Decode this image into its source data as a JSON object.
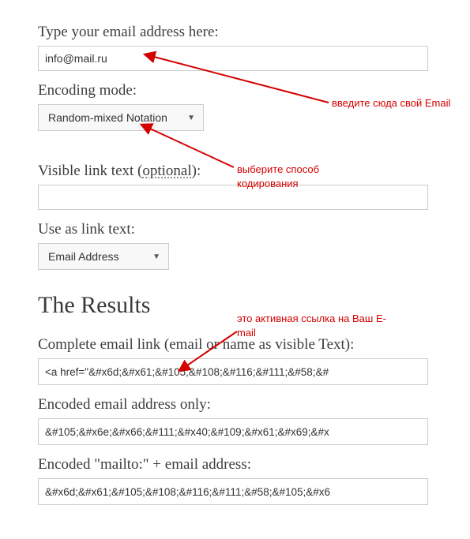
{
  "form": {
    "email_label": "Type your email address here:",
    "email_value": "info@mail.ru",
    "encoding_label": "Encoding mode:",
    "encoding_value": "Random-mixed Notation",
    "visible_label_pre": "Visible link text (",
    "visible_label_opt": "optional",
    "visible_label_post": "):",
    "visible_value": "",
    "linktext_label": "Use as link text:",
    "linktext_value": "Email Address"
  },
  "results": {
    "heading": "The Results",
    "complete_label": "Complete email link (email or name as visible Text):",
    "complete_value": "<a href=\"&#x6d;&#x61;&#105;&#108;&#116;&#111;&#58;&#",
    "encoded_only_label": "Encoded email address only:",
    "encoded_only_value": "&#105;&#x6e;&#x66;&#111;&#x40;&#109;&#x61;&#x69;&#x",
    "encoded_mailto_label": "Encoded \"mailto:\" + email address:",
    "encoded_mailto_value": "&#x6d;&#x61;&#105;&#108;&#116;&#111;&#58;&#105;&#x6"
  },
  "annotations": {
    "anno1": "введите сюда свой Email",
    "anno2": "выберите способ кодирования",
    "anno3": "это активная ссылка на Ваш E-mail"
  }
}
